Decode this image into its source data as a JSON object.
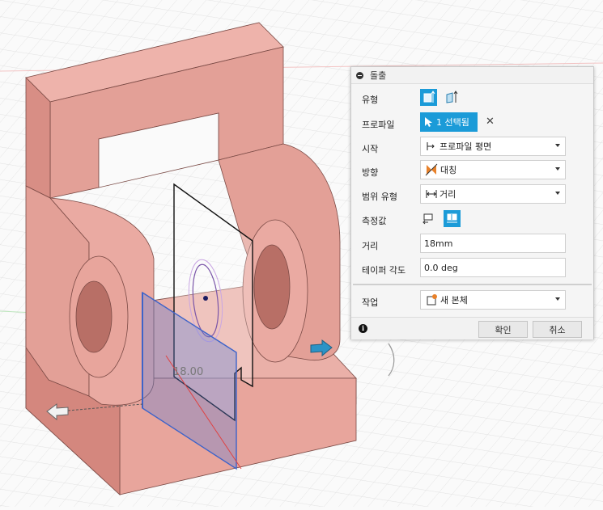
{
  "panel": {
    "title": "돌출",
    "type_label": "유형",
    "profile_label": "프로파일",
    "profile_value": "1 선택됨",
    "start_label": "시작",
    "start_value": "프로파일 평면",
    "direction_label": "방향",
    "direction_value": "대칭",
    "extent_type_label": "범위 유형",
    "extent_type_value": "거리",
    "measure_label": "측정값",
    "distance_label": "거리",
    "distance_value": "18mm",
    "taper_label": "테이퍼 각도",
    "taper_value": "0.0 deg",
    "operation_label": "작업",
    "operation_value": "새 본체",
    "ok_label": "확인",
    "cancel_label": "취소"
  },
  "viewport": {
    "dimension_label": "18.00"
  },
  "colors": {
    "accent": "#1b9bd8",
    "model_face": "#e8a59c",
    "model_side": "#d88e85",
    "sketch_plane": "#5b7fd6"
  }
}
